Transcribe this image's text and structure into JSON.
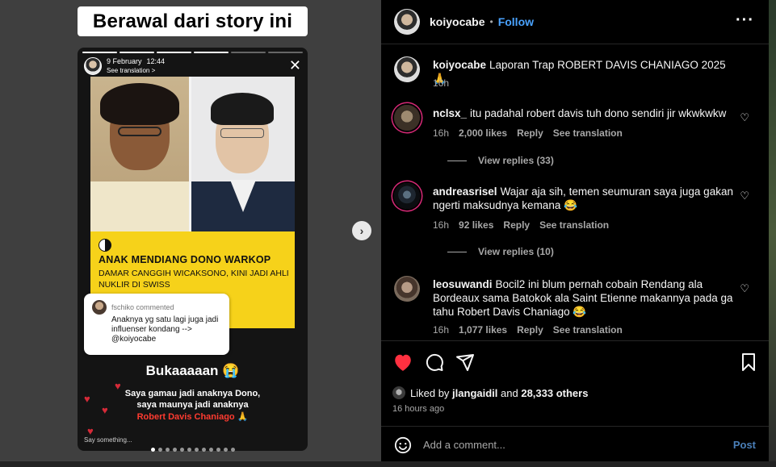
{
  "caption": "Berawal dari story ini",
  "story": {
    "date": "9 February",
    "time": "12:44",
    "see_translation": "See translation >",
    "close": "✕",
    "news_title": "ANAK MENDIANG DONO WARKOP",
    "news_sub": "DAMAR CANGGIH WICAKSONO, KINI JADI AHLI NUKLIR DI SWISS",
    "comment_user": "fschiko commented",
    "comment_text": "Anaknya yg satu lagi juga jadi influenser kondang --> @koiyocabe",
    "big_text": "Bukaaaaan 😭",
    "line1": "Saya gamau jadi anaknya Dono,",
    "line2": "saya maunya jadi anaknya",
    "line3": "Robert Davis Chaniago 🙏",
    "say_something": "Say something..."
  },
  "post": {
    "author": "koiyocabe",
    "dot": "•",
    "follow": "Follow",
    "more": "···",
    "caption_text": "Laporan Trap ROBERT DAVIS CHANIAGO 2025 🙏",
    "caption_time": "16h"
  },
  "comments": [
    {
      "user": "nclsx_",
      "text": "itu padahal robert davis tuh dono sendiri jir wkwkwkw",
      "time": "16h",
      "likes": "2,000 likes",
      "reply": "Reply",
      "translate": "See translation",
      "view_replies": "View replies (33)"
    },
    {
      "user": "andreasrisel",
      "text": "Wajar aja sih, temen seumuran saya juga gakan ngerti maksudnya kemana 😂",
      "time": "16h",
      "likes": "92 likes",
      "reply": "Reply",
      "translate": "See translation",
      "view_replies": "View replies (10)"
    },
    {
      "user": "leosuwandi",
      "text": "Bocil2 ini blum pernah cobain Rendang ala Bordeaux sama Batokok ala Saint Etienne makannya pada ga tahu Robert Davis Chaniago 😂",
      "time": "16h",
      "likes": "1,077 likes",
      "reply": "Reply",
      "translate": "See translation"
    }
  ],
  "likes": {
    "prefix": "Liked by",
    "user": "jlangaidil",
    "and": "and",
    "others": "28,333 others",
    "time": "16 hours ago"
  },
  "composer": {
    "placeholder": "Add a comment...",
    "post": "Post"
  },
  "colors": {
    "accent": "#4aa3ff",
    "like_red": "#ff3040",
    "panel_bg": "#000000",
    "news_yellow": "#f6d21a"
  },
  "icons": [
    "heart-filled-icon",
    "comment-icon",
    "share-icon",
    "bookmark-icon",
    "smile-icon",
    "heart-outline-icon",
    "chevron-right-icon",
    "close-icon",
    "more-icon"
  ]
}
